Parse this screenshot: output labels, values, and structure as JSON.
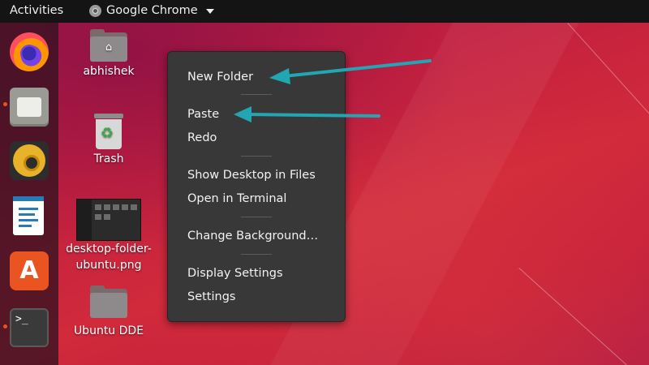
{
  "topbar": {
    "activities": "Activities",
    "app_name": "Google Chrome"
  },
  "dock": {
    "items": [
      {
        "name": "Firefox",
        "icon": "firefox-icon"
      },
      {
        "name": "Files",
        "icon": "files-icon"
      },
      {
        "name": "Rhythmbox",
        "icon": "rhythmbox-icon"
      },
      {
        "name": "LibreOffice Writer",
        "icon": "writer-icon"
      },
      {
        "name": "Ubuntu Software",
        "icon": "software-icon"
      },
      {
        "name": "Terminal",
        "icon": "terminal-icon",
        "prompt": ">_"
      }
    ]
  },
  "desktop": {
    "icons": [
      {
        "label": "abhishek",
        "icon": "home-folder-icon"
      },
      {
        "label": "Trash",
        "icon": "trash-icon"
      },
      {
        "label_line1": "desktop-folder-",
        "label_line2": "ubuntu.png",
        "icon": "image-thumbnail"
      },
      {
        "label": "Ubuntu DDE",
        "icon": "folder-icon"
      }
    ]
  },
  "context_menu": {
    "items": [
      "New Folder",
      "Paste",
      "Redo",
      "Show Desktop in Files",
      "Open in Terminal",
      "Change Background…",
      "Display Settings",
      "Settings"
    ]
  },
  "colors": {
    "accent_orange": "#e95420",
    "annotation_arrow": "#22a6b3",
    "menu_bg": "#383838",
    "topbar_bg": "#141414"
  }
}
